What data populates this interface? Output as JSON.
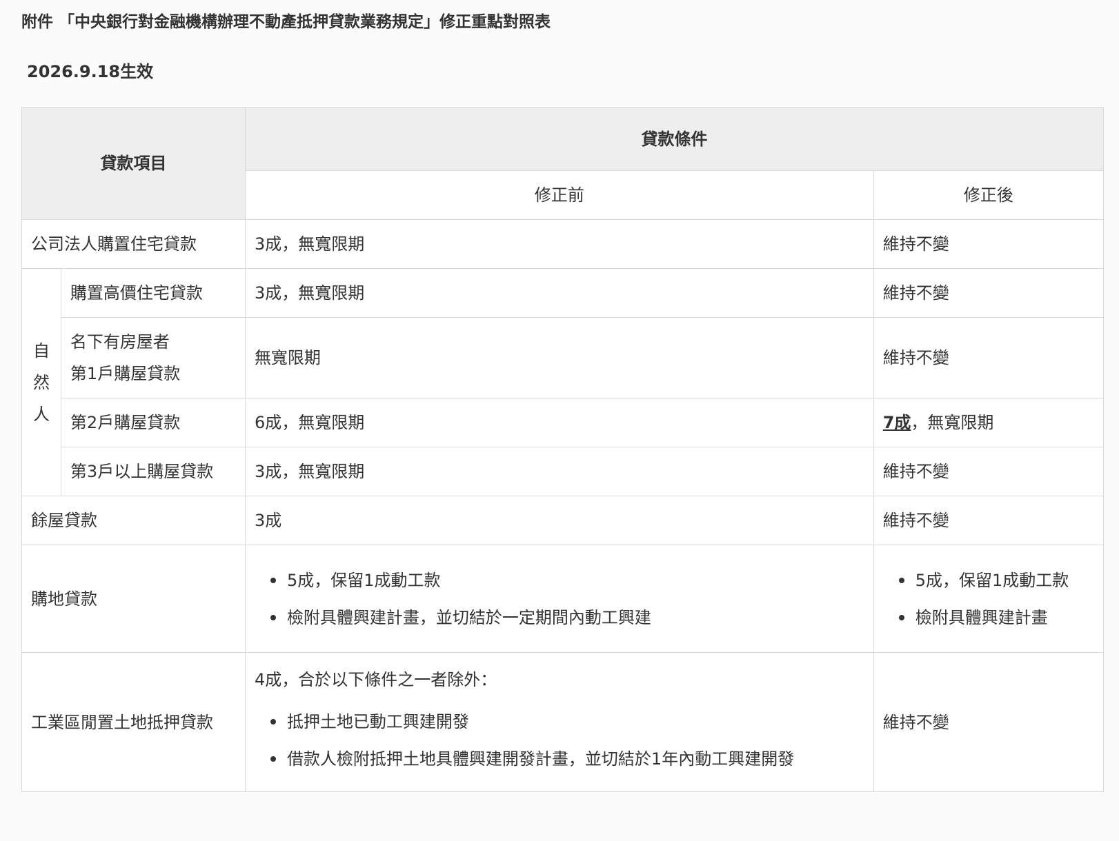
{
  "document": {
    "title": "附件 「中央銀行對金融機構辦理不動產抵押貸款業務規定」修正重點對照表",
    "effective_date": "2026.9.18生效"
  },
  "table": {
    "header": {
      "loan_item": "貸款項目",
      "loan_conditions": "貸款條件",
      "before": "修正前",
      "after": "修正後"
    },
    "rows": {
      "corporate": {
        "item": "公司法人購置住宅貸款",
        "before": "3成，無寬限期",
        "after": "維持不變"
      },
      "natural_person": {
        "group_chars": [
          "自",
          "然",
          "人"
        ],
        "high_price": {
          "item": "購置高價住宅貸款",
          "before": "3成，無寬限期",
          "after": "維持不變"
        },
        "first_home": {
          "item_line1": "名下有房屋者",
          "item_line2": "第1戶購屋貸款",
          "before": "無寬限期",
          "after": "維持不變"
        },
        "second_home": {
          "item": "第2戶購屋貸款",
          "before": "6成，無寬限期",
          "after_highlight": "7成",
          "after_rest": "，無寬限期"
        },
        "third_home": {
          "item": "第3戶以上購屋貸款",
          "before": "3成，無寬限期",
          "after": "維持不變"
        }
      },
      "surplus_house": {
        "item": "餘屋貸款",
        "before": "3成",
        "after": "維持不變"
      },
      "land_purchase": {
        "item": "購地貸款",
        "before": [
          "5成，保留1成動工款",
          "檢附具體興建計畫，並切結於一定期間內動工興建"
        ],
        "after": [
          "5成，保留1成動工款",
          "檢附具體興建計畫"
        ]
      },
      "industrial_land": {
        "item": "工業區閒置土地抵押貸款",
        "before_intro": "4成，合於以下條件之一者除外：",
        "before": [
          "抵押土地已動工興建開發",
          "借款人檢附抵押土地具體興建開發計畫，並切結於1年內動工興建開發"
        ],
        "after": "維持不變"
      }
    }
  }
}
